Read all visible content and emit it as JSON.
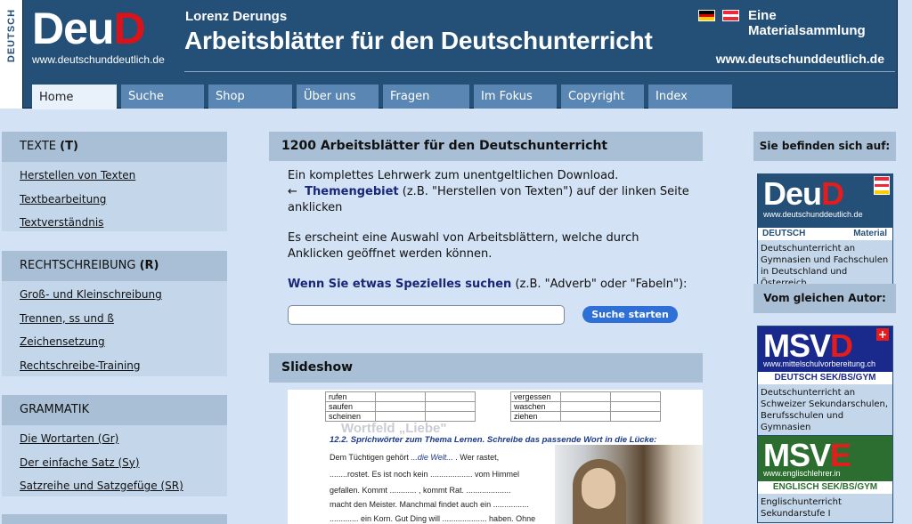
{
  "header": {
    "vertical_label": "DEUTSCH",
    "logo_part1": "Deu",
    "logo_part2": "D",
    "logo_url": "www.deutschunddeutlich.de",
    "author": "Lorenz Derungs",
    "headline": "Arbeitsblätter für den Deutschunterricht",
    "collection": "Eine Materialsammlung",
    "site_url": "www.deutschunddeutlich.de",
    "flags": [
      "flag-germany-icon",
      "flag-austria-icon"
    ]
  },
  "tabs": [
    {
      "label": "Home",
      "active": true
    },
    {
      "label": "Suche"
    },
    {
      "label": "Shop"
    },
    {
      "label": "Über uns"
    },
    {
      "label": "Fragen"
    },
    {
      "label": "Im Fokus"
    },
    {
      "label": "Copyright"
    },
    {
      "label": "Index"
    }
  ],
  "sidebar": {
    "sections": [
      {
        "title": "TEXTE",
        "code": "(T)",
        "links": [
          "Herstellen von Texten",
          "Textbearbeitung",
          "Textverständnis"
        ]
      },
      {
        "title": "RECHTSCHREIBUNG",
        "code": "(R)",
        "links": [
          "Groß- und Kleinschreibung",
          "Trennen, ss und ß",
          "Zeichensetzung",
          "Rechtschreibe-Training"
        ]
      },
      {
        "title": "GRAMMATIK",
        "code": "",
        "links": [
          "Die Wortarten (Gr)",
          "Der einfache Satz (Sy)",
          "Satzreihe und Satzgefüge (SR)"
        ]
      }
    ]
  },
  "main": {
    "heading": "1200 Arbeitsblätter für den Deutschunterricht",
    "intro_line1": "Ein komplettes Lehrwerk zum unentgeltlichen Download.",
    "arrow": "←",
    "topic_bold": "Themengebiet",
    "topic_rest": " (z.B. \"Herstellen von Texten\") auf der linken Seite anklicken",
    "paragraph2": "Es erscheint eine Auswahl von Arbeitsblättern, welche durch Anklicken geöffnet werden können.",
    "search_bold": "Wenn Sie etwas Spezielles suchen",
    "search_rest": " (z.B. \"Adverb\" oder \"Fabeln\"):",
    "search_value": "",
    "search_button": "Suche starten",
    "slideshow_heading": "Slideshow"
  },
  "slide": {
    "table_left": [
      "rufen",
      "saufen",
      "scheinen"
    ],
    "table_right": [
      "vergessen",
      "waschen",
      "ziehen"
    ],
    "watermark": "Wortfeld „Liebe\"",
    "title": "12.2. Sprichwörter zum Thema Lernen. Schreibe das passende Wort in die Lücke:",
    "line1_pre": "Dem Tüchtigen gehört ",
    "line1_em": "...die Welt...",
    "line1_post": " . Wer rastet,",
    "line2": "........rostet. Es ist noch kein ................... vom Himmel",
    "line3": "gefallen. Kommt  ............ , kommt Rat. ....................",
    "line4": "macht den Meister. Manchmal findet auch ein ................",
    "line5": "............. ein Korn. Gut Ding will .................... haben. Ohne"
  },
  "right": {
    "location_heading": "Sie befinden sich auf:",
    "same_author_heading": "Vom gleichen Autor:",
    "ads": [
      {
        "big1": "Deu",
        "big2": "D",
        "url": "www.deutschunddeutlich.de",
        "sub": "DEUTSCH",
        "sub2": "Material",
        "desc": "Deutschunterricht an Gymnasien und Fachschulen in Deutschland und Österreich",
        "bg": "#244f77",
        "accent": "#e31d1d"
      },
      {
        "big1": "MSV",
        "big2": "D",
        "url": "www.mittelschulvorbereitung.ch",
        "sub": "DEUTSCH SEK/BS/GYM",
        "sub2": "",
        "desc": "Deutschunterricht an Schweizer Sekundarschulen, Berufsschulen und Gymnasien",
        "bg": "#1a2a8c",
        "accent": "#e31d1d"
      },
      {
        "big1": "MSV",
        "big2": "E",
        "url": "www.englischlehrer.in",
        "sub": "ENGLISCH SEK/BS/GYM",
        "sub2": "",
        "desc": "Englischunterricht Sekundarstufe I",
        "bg": "#2c6e2f",
        "accent": "#e31d1d"
      }
    ]
  }
}
